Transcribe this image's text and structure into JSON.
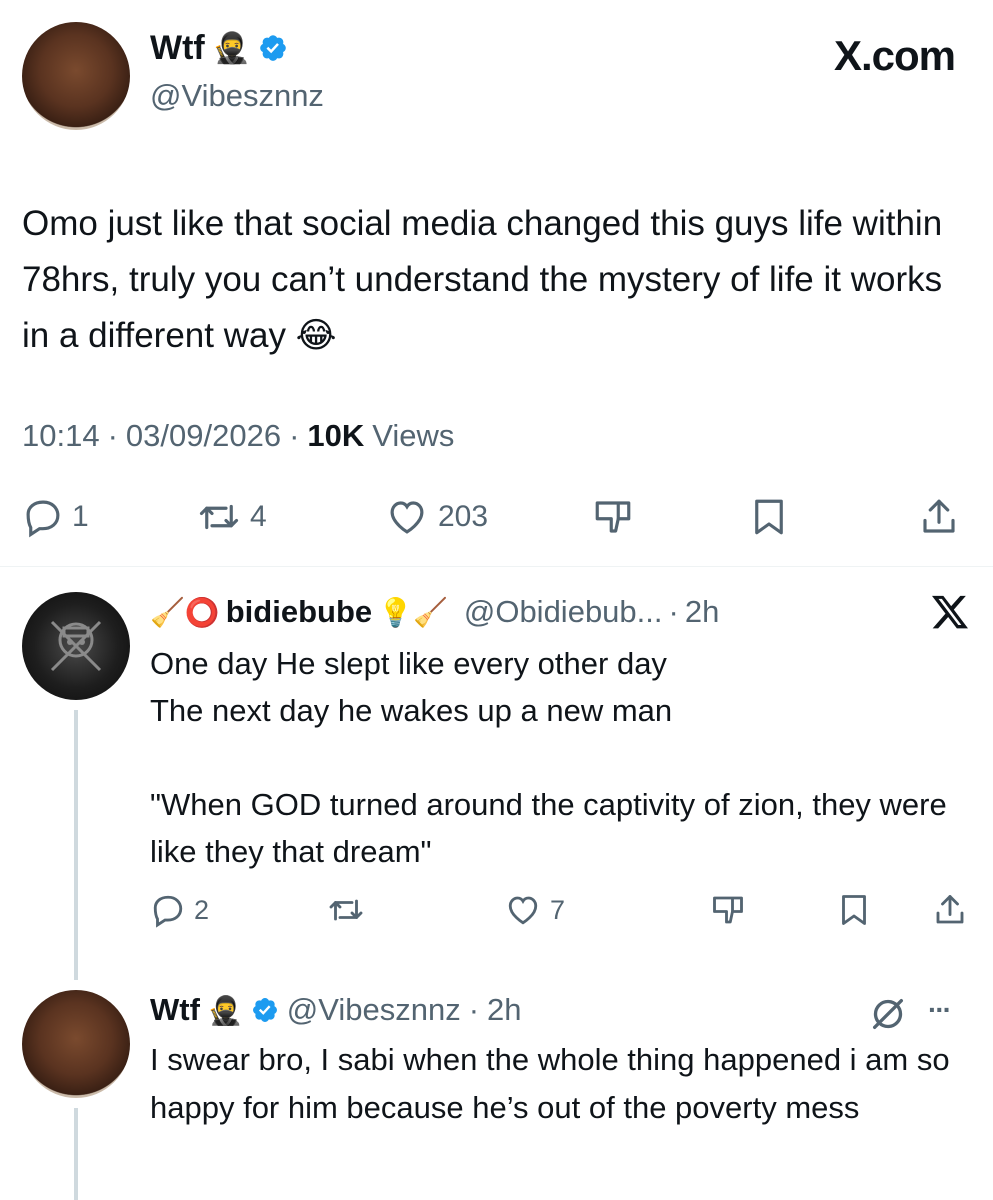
{
  "main_tweet": {
    "author_name": "Wtf",
    "author_emoji": "🥷",
    "handle": "@Vibesznnz",
    "brand": "X.com",
    "text": "Omo just like that social media changed this guys life within 78hrs, truly you can’t understand the mystery of life it works in a different way 😂",
    "time": "10:14",
    "date": "03/09/2026",
    "views_count": "10K",
    "views_label": "Views",
    "replies": "1",
    "reposts": "4",
    "likes": "203"
  },
  "reply_1": {
    "name_prefix": "🧹⭕",
    "name": "bidiebube",
    "name_suffix": "💡🧹",
    "handle": "@Obidiebub...",
    "time": "2h",
    "text": "One day He slept like every other day\nThe next day he wakes up a new man\n\n\"When GOD turned around the captivity of zion, they were  like they that dream\"",
    "replies": "2",
    "reposts": "",
    "likes": "7"
  },
  "reply_2": {
    "author_name": "Wtf",
    "author_emoji": "🥷",
    "handle": "@Vibesznnz",
    "time": "2h",
    "text": "I swear bro, I sabi when the whole thing happened i am so happy for him because he’s out of the poverty mess",
    "more_icon": "···"
  },
  "colors": {
    "text": "#0f1419",
    "muted": "#536471",
    "verified": "#1d9bf0",
    "divider": "#eff3f4",
    "thread_line": "#cfd9de"
  }
}
